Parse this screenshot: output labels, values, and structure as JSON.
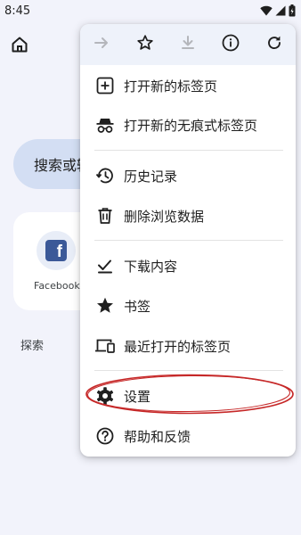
{
  "status_bar": {
    "time": "8:45",
    "icons": [
      "wifi-icon",
      "signal-icon",
      "battery-icon"
    ]
  },
  "background_page": {
    "search_placeholder": "搜索或输",
    "shortcut": {
      "label": "Facebook",
      "icon": "facebook-icon",
      "glyph": "f"
    },
    "explore_label": "探索"
  },
  "menu": {
    "toolbar_icons": [
      "forward-icon",
      "bookmark-star-icon",
      "download-icon",
      "info-icon",
      "refresh-icon"
    ],
    "items": [
      {
        "label": "打开新的标签页",
        "icon": "new-tab-icon"
      },
      {
        "label": "打开新的无痕式标签页",
        "icon": "incognito-icon"
      },
      {
        "label": "历史记录",
        "icon": "history-icon"
      },
      {
        "label": "删除浏览数据",
        "icon": "delete-icon"
      },
      {
        "label": "下载内容",
        "icon": "downloads-icon"
      },
      {
        "label": "书签",
        "icon": "star-icon"
      },
      {
        "label": "最近打开的标签页",
        "icon": "recent-tabs-icon"
      },
      {
        "label": "设置",
        "icon": "settings-gear-icon"
      },
      {
        "label": "帮助和反馈",
        "icon": "help-icon"
      }
    ]
  },
  "colors": {
    "page_background": "#f2f3fb",
    "search_box": "#d3def3",
    "toolbar_background": "#eef2fa",
    "highlight_annotation": "#c62828",
    "facebook_blue": "#3b5998"
  }
}
